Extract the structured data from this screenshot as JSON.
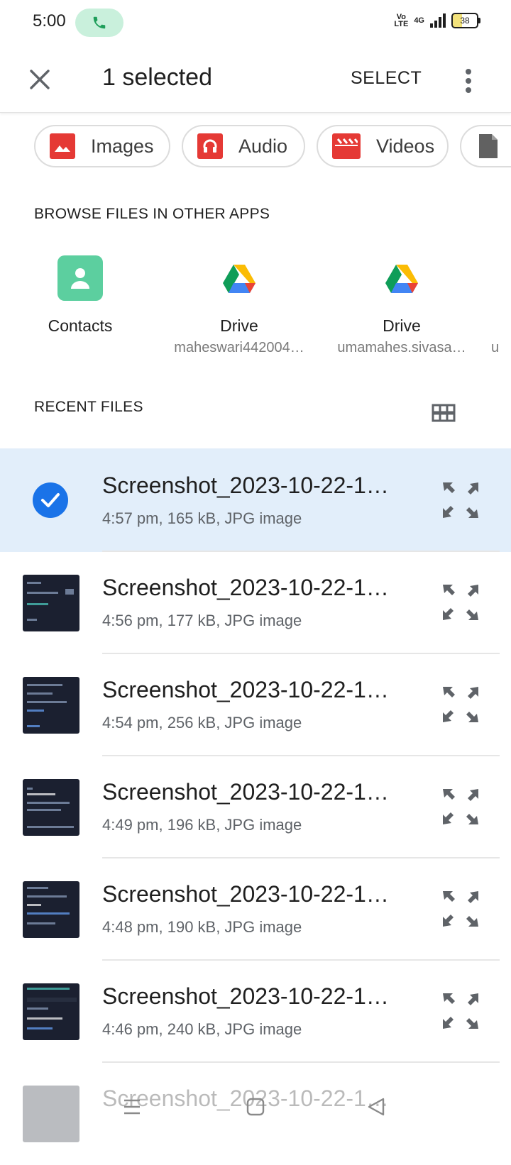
{
  "status_bar": {
    "time": "5:00",
    "battery": "38",
    "network": "4G",
    "volte": "Vo LTE"
  },
  "toolbar": {
    "title": "1 selected",
    "select_label": "SELECT"
  },
  "chips": [
    {
      "label": "Images",
      "icon": "image-icon",
      "color": "#e53935"
    },
    {
      "label": "Audio",
      "icon": "headphones-icon",
      "color": "#e53935"
    },
    {
      "label": "Videos",
      "icon": "clapperboard-icon",
      "color": "#e53935"
    },
    {
      "label": "",
      "icon": "document-icon",
      "color": "#616161"
    }
  ],
  "browse": {
    "title": "BROWSE FILES IN OTHER APPS",
    "apps": [
      {
        "name": "Contacts",
        "sub": ""
      },
      {
        "name": "Drive",
        "sub": "maheswari442004…"
      },
      {
        "name": "Drive",
        "sub": "umamahes.sivasa…"
      },
      {
        "name": "",
        "sub": "u"
      }
    ]
  },
  "recent": {
    "title": "RECENT FILES",
    "files": [
      {
        "name": "Screenshot_2023-10-22-1…",
        "meta": "4:57 pm, 165 kB, JPG image",
        "selected": true
      },
      {
        "name": "Screenshot_2023-10-22-1…",
        "meta": "4:56 pm, 177 kB, JPG image",
        "selected": false
      },
      {
        "name": "Screenshot_2023-10-22-1…",
        "meta": "4:54 pm, 256 kB, JPG image",
        "selected": false
      },
      {
        "name": "Screenshot_2023-10-22-1…",
        "meta": "4:49 pm, 196 kB, JPG image",
        "selected": false
      },
      {
        "name": "Screenshot_2023-10-22-1…",
        "meta": "4:48 pm, 190 kB, JPG image",
        "selected": false
      },
      {
        "name": "Screenshot_2023-10-22-1…",
        "meta": "4:46 pm, 240 kB, JPG image",
        "selected": false
      },
      {
        "name": "Screenshot_2023-10-22-1…",
        "meta": "",
        "selected": false
      }
    ]
  },
  "colors": {
    "accent": "#1a73e8",
    "selected_row": "#e2eefa",
    "contacts_green": "#5ccf9f"
  }
}
